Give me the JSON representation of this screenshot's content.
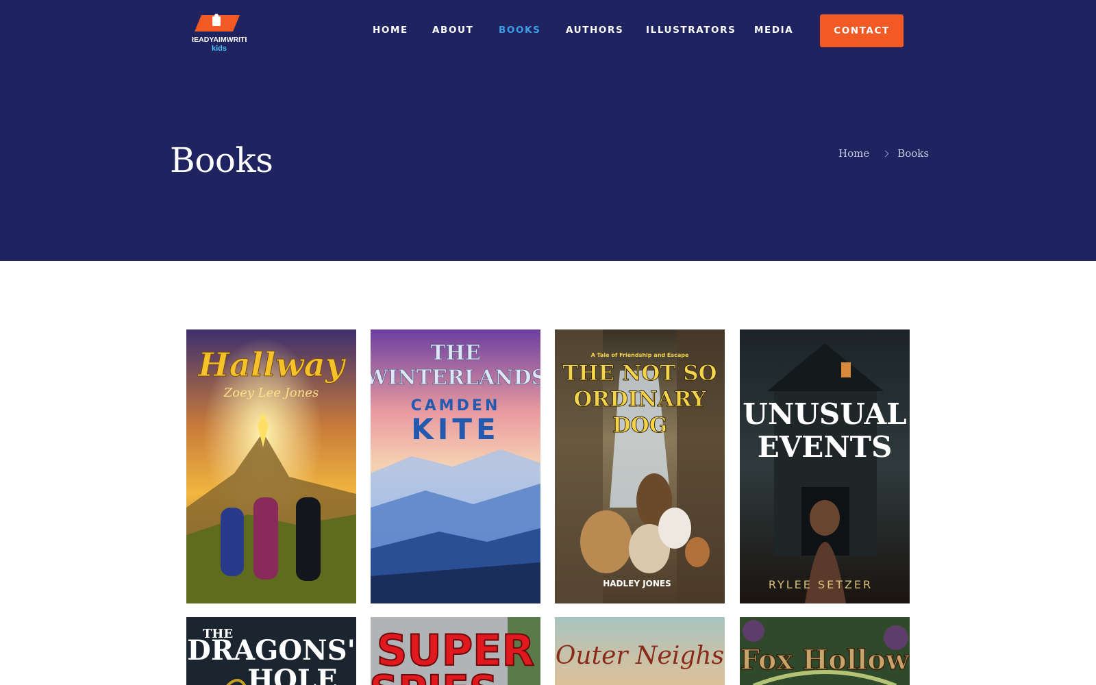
{
  "brand": {
    "logo_line1": "READYAIMWRITE",
    "logo_line2": "kids",
    "colors": {
      "navy": "#1f2461",
      "orange": "#f15a24",
      "active_blue": "#3b9fe8"
    }
  },
  "nav": {
    "items": [
      {
        "label": "HOME",
        "active": false
      },
      {
        "label": "ABOUT",
        "active": false
      },
      {
        "label": "BOOKS",
        "active": true
      },
      {
        "label": "AUTHORS",
        "active": false
      },
      {
        "label": "ILLUSTRATORS",
        "active": false
      },
      {
        "label": "MEDIA",
        "active": false
      }
    ],
    "contact_label": "CONTACT"
  },
  "hero": {
    "title": "Books",
    "breadcrumb": [
      "Home",
      "Books"
    ]
  },
  "books": [
    {
      "title": "Hallway",
      "author": "Zoey Lee Jones"
    },
    {
      "title_line1": "THE",
      "title_line2": "WINTERLANDS",
      "author_line1": "CAMDEN",
      "author_line2": "KITE"
    },
    {
      "tagline": "A Tale of Friendship and Escape",
      "title_line1": "THE NOT SO",
      "title_line2": "ORDINARY",
      "title_line3": "DOG",
      "author": "HADLEY JONES"
    },
    {
      "title_line1": "UNUSUAL",
      "title_line2": "EVENTS",
      "author": "RYLEE SETZER"
    },
    {
      "title_line1": "THE",
      "title_line2": "DRAGONS'",
      "title_line3": "HOLE"
    },
    {
      "title_line1": "SUPER",
      "title_line2": "SPIES"
    },
    {
      "title": "Outer Neighs"
    },
    {
      "title": "Fox Hollow"
    }
  ]
}
